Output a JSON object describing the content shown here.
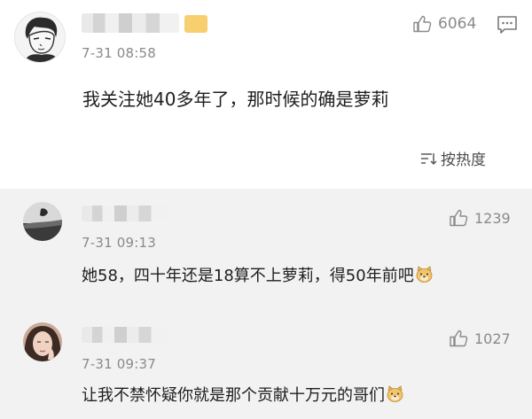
{
  "main_comment": {
    "time": "7-31 08:58",
    "like_count": "6064",
    "text": "我关注她40多年了，那时候的确是萝莉",
    "sort_label": "按热度"
  },
  "replies": [
    {
      "time": "7-31 09:13",
      "like_count": "1239",
      "text": "她58，四十年还是18算不上萝莉，得50年前吧"
    },
    {
      "time": "7-31 09:37",
      "like_count": "1027",
      "text": "让我不禁怀疑你就是那个贡献十万元的哥们"
    }
  ],
  "icons": {
    "like": "thumbs-up-icon",
    "reply": "comment-icon",
    "sort": "sort-icon",
    "emoji": "doge-emoji-icon"
  }
}
